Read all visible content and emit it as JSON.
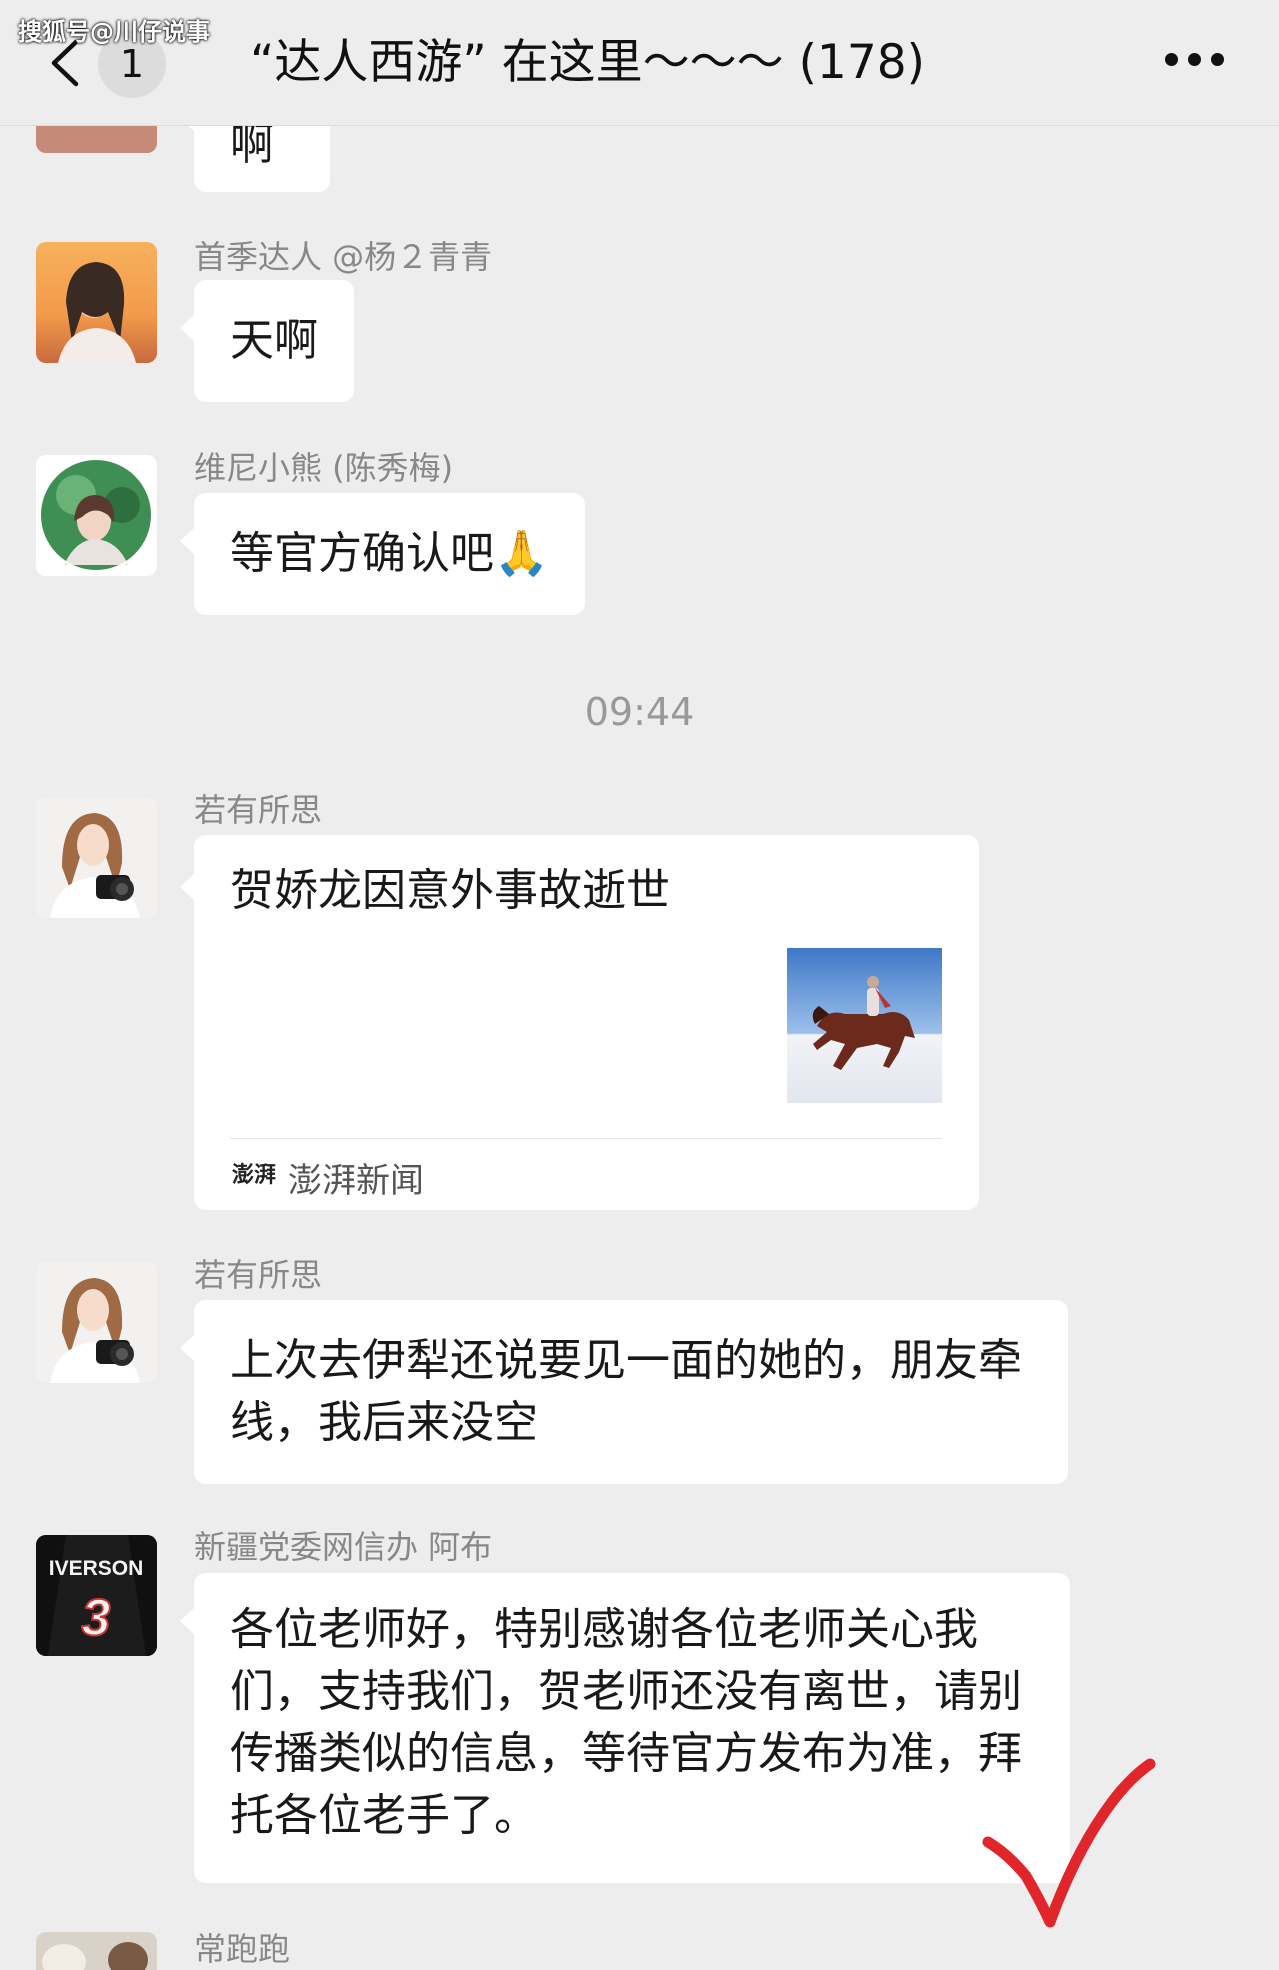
{
  "watermark": "搜狐号@川仔说事",
  "header": {
    "unread_count": "1",
    "title": "“达人西游” 在这里～～～ (178)"
  },
  "messages": [
    {
      "id": "m0",
      "sender": "",
      "text": "啊"
    },
    {
      "id": "m1",
      "sender": "首季达人 @杨２青青",
      "text": "天啊"
    },
    {
      "id": "m2",
      "sender": "维尼小熊 (陈秀梅)",
      "text": "等官方确认吧🙏"
    },
    {
      "id": "m4",
      "sender": "若有所思",
      "text": "上次去伊犁还说要见一面的她的，朋友牵线，我后来没空"
    },
    {
      "id": "m5",
      "sender": "新疆党委网信办 阿布",
      "text": "各位老师好，特别感谢各位老师关心我们，支持我们，贺老师还没有离世，请别传播类似的信息，等待官方发布为准，拜托各位老手了。"
    },
    {
      "id": "m6",
      "sender": "常跑跑",
      "text": ""
    }
  ],
  "timestamp": "09:44",
  "link_card": {
    "sender": "若有所思",
    "title": "贺娇龙因意外事故逝世",
    "source_logo": "澎湃",
    "source": "澎湃新闻"
  },
  "avatars": {
    "iverson_jersey_text": "IVERSON",
    "iverson_number": "3"
  },
  "colors": {
    "background": "#ededed",
    "bubble": "#ffffff",
    "sender_name": "#888888",
    "checkmark": "#e0262b"
  }
}
